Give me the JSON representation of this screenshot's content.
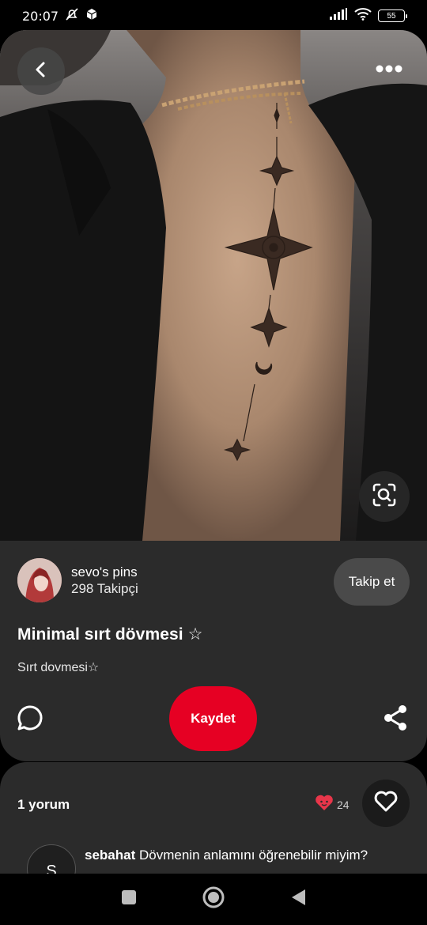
{
  "status_bar": {
    "time": "20:07",
    "battery": "55"
  },
  "icons": {
    "back": "chevron-left-icon",
    "more": "more-horizontal-icon",
    "lens": "visual-search-icon",
    "comment": "speech-bubble-icon",
    "share": "share-icon",
    "like": "heart-outline-icon",
    "reaction": "heart-face-icon"
  },
  "creator": {
    "name": "sevo's pins",
    "followers": "298 Takipçi",
    "follow_label": "Takip et"
  },
  "pin": {
    "title": "Minimal sırt dövmesi ☆",
    "description": "Sırt dovmesi☆",
    "save_label": "Kaydet"
  },
  "comments": {
    "count_label": "1 yorum",
    "reaction_count": "24",
    "items": [
      {
        "avatar_initial": "S",
        "author": "sebahat",
        "text": "Dövmenin anlamını öğrenebilir miyim?"
      }
    ]
  },
  "colors": {
    "accent": "#e60023",
    "surface": "#2b2b2b",
    "reaction": "#e8364a"
  }
}
